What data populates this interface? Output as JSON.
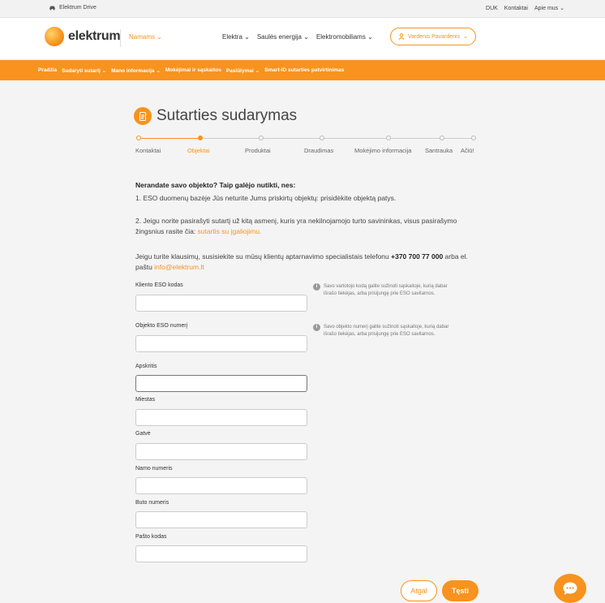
{
  "topbar": {
    "drive_label": "Elektrum Drive",
    "links": [
      "DUK",
      "Kontaktai",
      "Apie mus"
    ]
  },
  "header": {
    "logo_text": "elektrum",
    "segment": "Namams",
    "nav": [
      "Elektra",
      "Saulės energija",
      "Elektromobiliams"
    ],
    "user": "Vardenis Pavardenis"
  },
  "subnav": {
    "items": [
      "Pradžia",
      "Sudaryti sutartį",
      "Mano informacija",
      "Mokėjimai ir sąskaitos",
      "Pasiūlymai",
      "Smart-ID sutarties patvirtinimas"
    ]
  },
  "page": {
    "title": "Sutarties sudarymas"
  },
  "steps": [
    "Kontaktai",
    "Objektai",
    "Produktai",
    "Draudimas",
    "Mokėjimo informacija",
    "Santrauka",
    "Ačiū!"
  ],
  "notice": {
    "heading": "Nerandate savo objekto? Taip galėjo nutikti, nes:",
    "p1": "1. ESO duomenų bazėje Jūs neturite Jums priskirtų objektų: prisidėkite objektą patys.",
    "p2_text": "2. Jeigu norite pasirašyti sutartį už kitą asmenį, kuris yra nekilnojamojo turto savininkas, visus pasirašymo žingsnius rasite čia: ",
    "p2_link": "sutartis su įgaliojimu.",
    "p3_text": "Jeigu turite klausimų, susisiekite su mūsų klientų aptarnavimo specialistais telefonu ",
    "p3_phone": "+370 700 77 000",
    "p3_mid": " arba el. paštu ",
    "p3_email": "info@elektrum.lt"
  },
  "form": {
    "client_eso_label": "Kliento ESO kodas",
    "object_eso_label": "Objekto ESO numerį",
    "county_label": "Apskritis",
    "city_label": "Miestas",
    "street_label": "Gatvė",
    "house_label": "Namo numeris",
    "apt_label": "Buto numeris",
    "postal_label": "Pašto kodas",
    "hint_client": "Savo vartotojo kodą galite sužinoti sąskaitoje, kurią dabar išrašo tiekėjas, arba prisijungę prie ESO savitarnos.",
    "hint_object": "Savo objekto numerį galite sužinoti sąskaitoje, kurią dabar išrašo tiekėjas, arba prisijungę prie ESO savitarnos."
  },
  "actions": {
    "back": "Atgal",
    "next": "Tęsti"
  },
  "colors": {
    "accent": "#f7931e"
  }
}
